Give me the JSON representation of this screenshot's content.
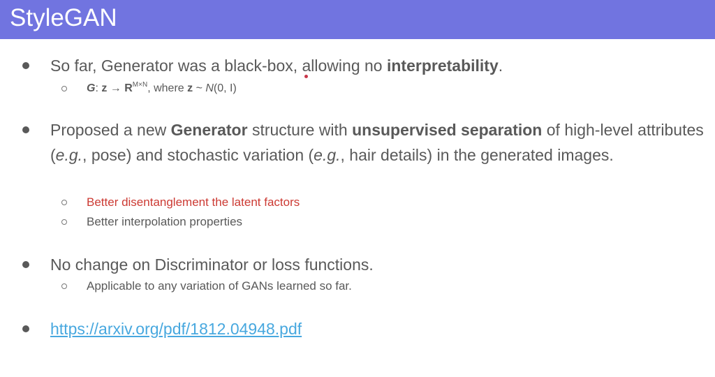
{
  "slide": {
    "title": "StyleGAN"
  },
  "bullets": [
    {
      "parts": [
        {
          "t": "So far, Generator was a black-box, allowing no ",
          "b": false
        },
        {
          "t": "interpretability",
          "b": true
        },
        {
          "t": ".",
          "b": false
        }
      ],
      "sub": [
        {
          "kind": "math",
          "g": "G",
          "colon": ": ",
          "z": "z",
          "arrow": " → ",
          "R": "R",
          "sup": "M×N",
          "where": ", where ",
          "z2": "z",
          "tilde": " ~ ",
          "N": "N",
          "args": "(0, I)"
        }
      ]
    },
    {
      "parts": [
        {
          "t": "Proposed a new ",
          "b": false
        },
        {
          "t": "Generator",
          "b": true
        },
        {
          "t": " structure with ",
          "b": false
        },
        {
          "t": "unsupervised separation",
          "b": true
        },
        {
          "t": " of high-level attributes (",
          "b": false
        },
        {
          "t": "e.g.",
          "i": true
        },
        {
          "t": ", pose) and stochastic variation (",
          "b": false
        },
        {
          "t": "e.g.",
          "i": true
        },
        {
          "t": ", hair details) in the generated images.",
          "b": false
        }
      ],
      "sub": [
        {
          "text": "Better disentanglement the latent factors",
          "color": "#cc3a33"
        },
        {
          "text": "Better interpolation properties",
          "color": "#595959"
        }
      ]
    },
    {
      "parts": [
        {
          "t": "No change on Discriminator or loss functions.",
          "b": false
        }
      ],
      "sub": [
        {
          "text": "Applicable to any variation of GANs learned so far.",
          "color": "#595959"
        }
      ]
    },
    {
      "link": "https://arxiv.org/pdf/1812.04948.pdf"
    }
  ],
  "colors": {
    "title_bar": "#7174e0",
    "text": "#595959",
    "highlight": "#cc3a33",
    "link": "#48a8df"
  }
}
